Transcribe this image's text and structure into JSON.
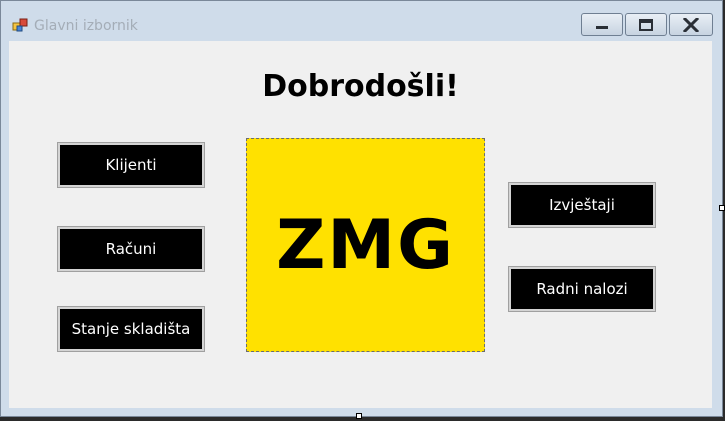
{
  "window": {
    "title": "Glavni izbornik",
    "buttons": {
      "minimize": "minimize-icon",
      "maximize": "maximize-icon",
      "close": "close-icon"
    }
  },
  "main": {
    "heading": "Dobrodošli!",
    "logo_text": "ZMG",
    "left_buttons": [
      "Klijenti",
      "Računi",
      "Stanje skladišta"
    ],
    "right_buttons": [
      "Izvještaji",
      "Radni nalozi"
    ]
  },
  "colors": {
    "logo_background": "#ffe100",
    "button_background": "#000000",
    "button_text": "#ffffff",
    "client_background": "#f0f0f0"
  }
}
